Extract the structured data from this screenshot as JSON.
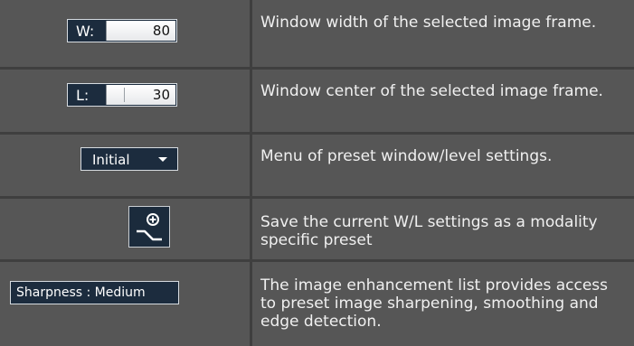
{
  "window_width": {
    "label": "W:",
    "value": "80"
  },
  "window_center": {
    "label": "L:",
    "value": "30"
  },
  "preset_menu": {
    "selected": "Initial"
  },
  "save_preset": {
    "icon": "save-preset-icon"
  },
  "enhancement": {
    "selected": "Sharpness : Medium"
  },
  "descriptions": {
    "width": "Window width of the selected image frame.",
    "center": "Window center of the selected image frame.",
    "preset": "Menu of preset window/level settings.",
    "save_line1": "Save the current W/L settings as a modality",
    "save_line2": "specific preset",
    "enh_line1": "The image enhancement list provides access",
    "enh_line2": "to preset image sharpening, smoothing and",
    "enh_line3": "edge detection."
  },
  "colors": {
    "row_bg": "#565656",
    "control_bg": "#1c2c3e",
    "text": "#f0f0f0"
  }
}
